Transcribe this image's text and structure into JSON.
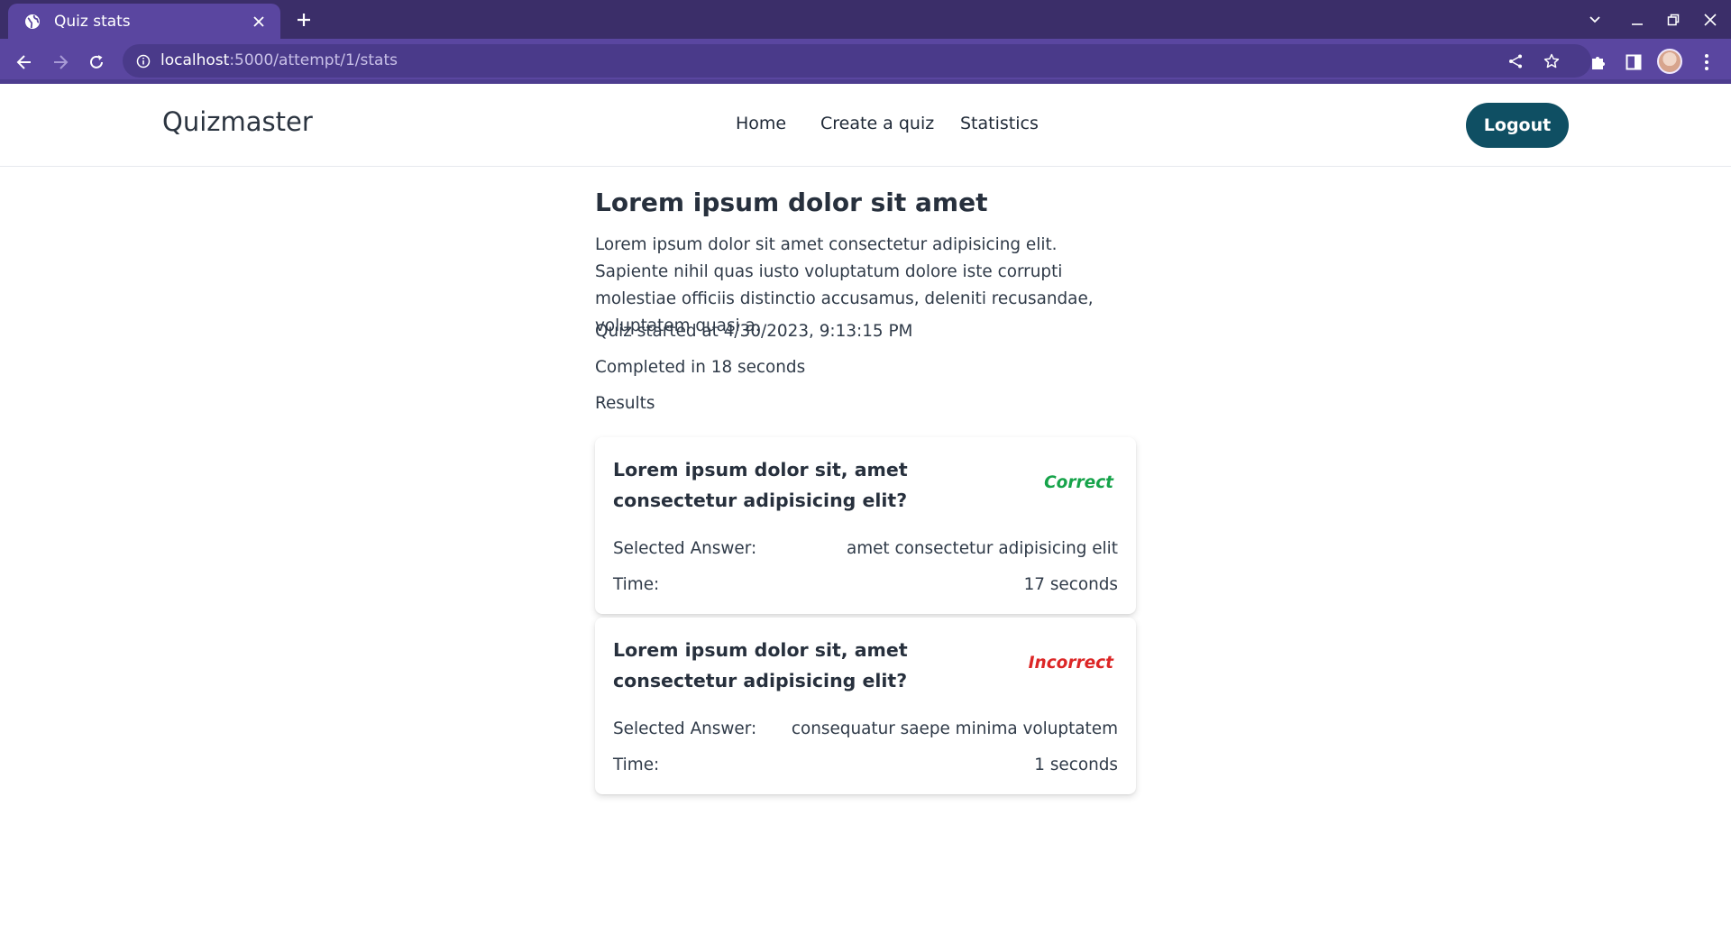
{
  "browser": {
    "tab_title": "Quiz stats",
    "url_host": "localhost",
    "url_path": ":5000/attempt/1/stats",
    "icons": [
      "globe-icon",
      "close-icon",
      "plus-icon",
      "chevron-down-icon",
      "minimize-icon",
      "restore-icon",
      "window-close-icon",
      "back-arrow-icon",
      "forward-arrow-icon",
      "reload-icon",
      "info-icon",
      "share-icon",
      "star-icon",
      "puzzle-icon",
      "side-panel-icon",
      "avatar",
      "more-vert-icon"
    ],
    "colors": {
      "tabstrip": "#3b2e69",
      "toolbar": "#5a46a0",
      "omnibox": "#4a3a8a"
    }
  },
  "navbar": {
    "brand": "Quizmaster",
    "links": [
      "Home",
      "Create a quiz",
      "Statistics"
    ],
    "logout_label": "Logout",
    "colors": {
      "logout_bg": "#0f4f63"
    }
  },
  "quiz": {
    "title": "Lorem ipsum dolor sit amet",
    "description": "Lorem ipsum dolor sit amet consectetur adipisicing elit. Sapiente nihil quas iusto voluptatum dolore iste corrupti molestiae officiis distinctio accusamus, deleniti recusandae, voluptatem quasi a.",
    "started_at": "Quiz started at 4/30/2023, 9:13:15 PM",
    "completed_in": "Completed in 18 seconds",
    "results_label": "Results"
  },
  "results": [
    {
      "question": "Lorem ipsum dolor sit, amet consectetur adipisicing elit?",
      "verdict": "Correct",
      "verdict_color": "#16a34a",
      "selected_label": "Selected Answer:",
      "selected_answer": "amet consectetur adipisicing elit",
      "time_label": "Time:",
      "time_value": "17 seconds"
    },
    {
      "question": "Lorem ipsum dolor sit, amet consectetur adipisicing elit?",
      "verdict": "Incorrect",
      "verdict_color": "#dc2626",
      "selected_label": "Selected Answer:",
      "selected_answer": "consequatur saepe minima voluptatem",
      "time_label": "Time:",
      "time_value": "1 seconds"
    }
  ]
}
